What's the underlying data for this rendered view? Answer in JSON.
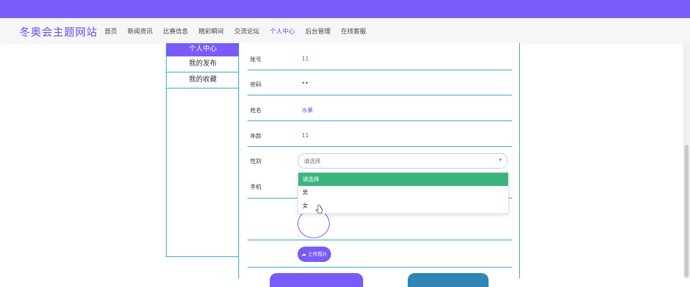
{
  "header": {
    "brand": "冬奥会主题网站",
    "nav": [
      {
        "label": "首页",
        "active": false
      },
      {
        "label": "新闻资讯",
        "active": false
      },
      {
        "label": "比赛信息",
        "active": false
      },
      {
        "label": "精彩瞬间",
        "active": false
      },
      {
        "label": "交流论坛",
        "active": false
      },
      {
        "label": "个人中心",
        "active": true
      },
      {
        "label": "后台管理",
        "active": false
      },
      {
        "label": "在线客服",
        "active": false
      }
    ]
  },
  "sidebar": {
    "title": "个人中心",
    "items": [
      {
        "label": "我的发布"
      },
      {
        "label": "我的收藏"
      }
    ]
  },
  "form": {
    "fields": [
      {
        "label": "账号",
        "value": "11"
      },
      {
        "label": "密码",
        "value": "••"
      },
      {
        "label": "姓名",
        "value": "水果"
      },
      {
        "label": "年龄",
        "value": "11"
      },
      {
        "label": "性别",
        "value": ""
      },
      {
        "label": "手机",
        "value": ""
      }
    ],
    "gender_placeholder": "请选择",
    "gender_options": [
      "请选择",
      "男",
      "女"
    ],
    "upload_label": "上传图片"
  },
  "colors": {
    "accent": "#7a5af8",
    "option_selected": "#3bb57f",
    "border": "#3aa3c9"
  }
}
